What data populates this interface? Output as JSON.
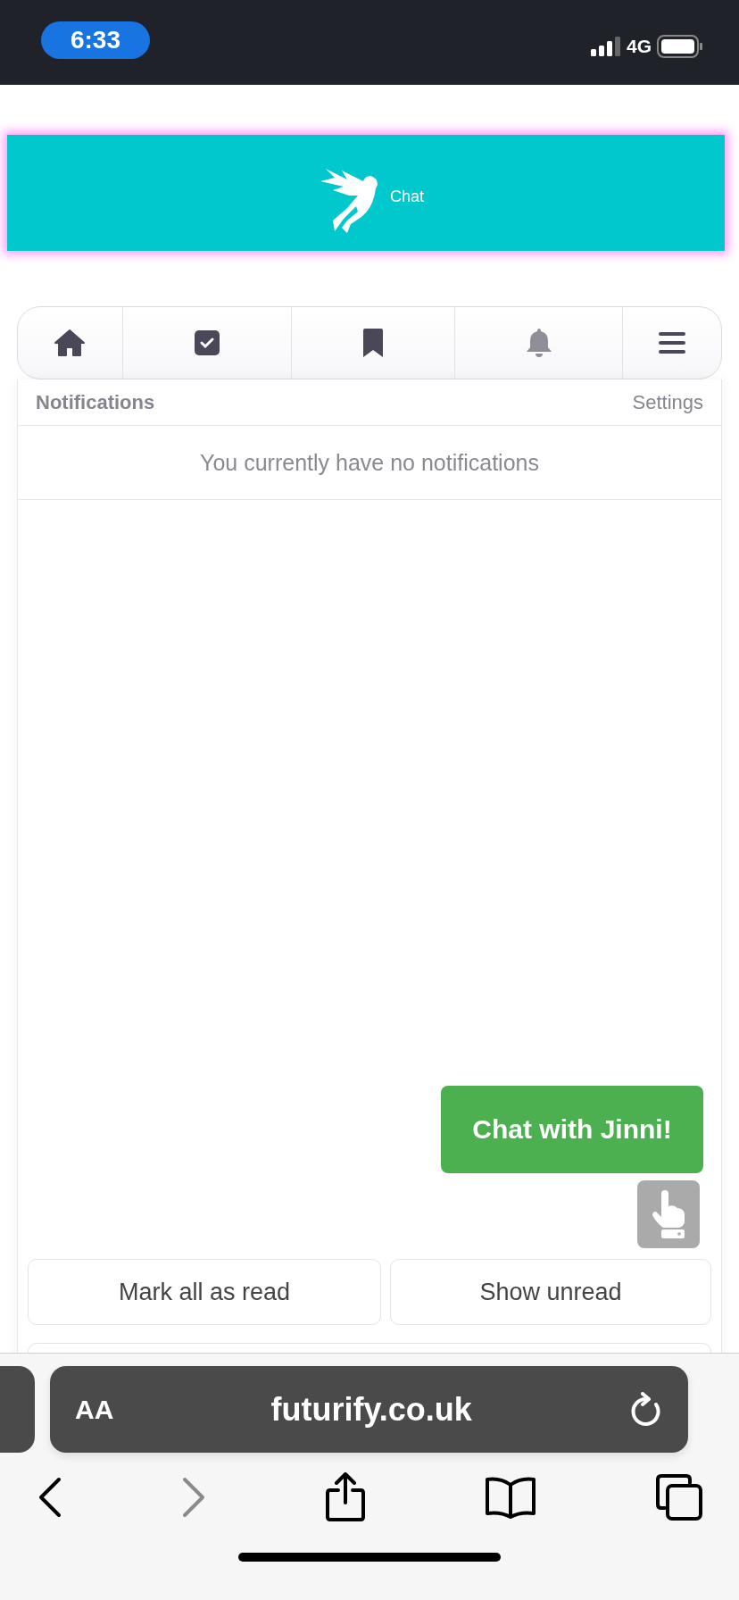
{
  "status_bar": {
    "time": "6:33",
    "network": "4G"
  },
  "header": {
    "title": "Chat"
  },
  "nav": [
    {
      "kind": "home",
      "selected": false
    },
    {
      "kind": "check",
      "selected": false
    },
    {
      "kind": "bookmark",
      "selected": false
    },
    {
      "kind": "bell",
      "selected": true
    },
    {
      "kind": "menu",
      "selected": false
    }
  ],
  "panel": {
    "title": "Notifications",
    "settings": "Settings",
    "message": "You currently have no notifications"
  },
  "chat_button": "Chat with Jinni!",
  "actions": [
    "Mark all as read",
    "Show unread"
  ],
  "browser": {
    "text_size": "AA",
    "url": "futurify.co.uk",
    "toolbar": [
      {
        "kind": "back",
        "disabled": false
      },
      {
        "kind": "forward",
        "disabled": true
      },
      {
        "kind": "share",
        "disabled": false
      },
      {
        "kind": "book",
        "disabled": false
      },
      {
        "kind": "tabs",
        "disabled": false
      }
    ]
  }
}
